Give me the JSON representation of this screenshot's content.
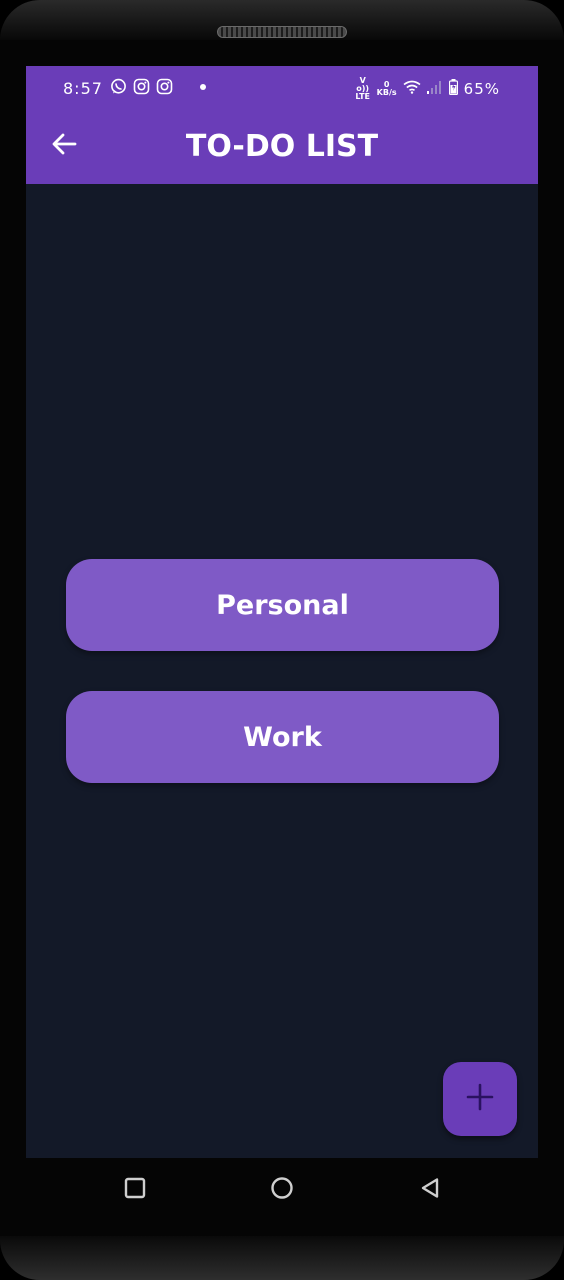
{
  "status_bar": {
    "time": "8:57",
    "notification_icons": [
      "whatsapp-icon",
      "instagram-icon",
      "instagram-icon"
    ],
    "volte_label": "Vo)) LTE",
    "data_speed_value": "0",
    "data_speed_unit": "KB/s",
    "battery_percent": "65%"
  },
  "app_bar": {
    "title": "TO-DO LIST",
    "back_icon": "arrow-left-icon"
  },
  "lists": [
    {
      "label": "Personal"
    },
    {
      "label": "Work"
    }
  ],
  "fab": {
    "icon": "plus-icon"
  },
  "nav_bar": {
    "icons": [
      "recent-apps-icon",
      "home-icon",
      "back-triangle-icon"
    ]
  },
  "colors": {
    "primary": "#6a3db8",
    "button": "#7f5ac6",
    "background": "#131928",
    "fab_icon": "#2a1260"
  }
}
